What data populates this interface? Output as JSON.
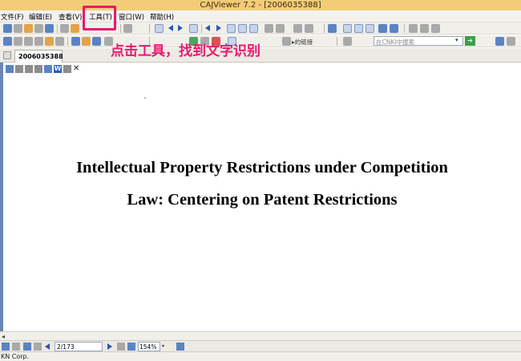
{
  "window": {
    "title": "CAJViewer 7.2 - [2006035388]"
  },
  "menu": [
    {
      "label": "文件(F)"
    },
    {
      "label": "编辑(E)"
    },
    {
      "label": "查看(V)"
    },
    {
      "label": "工具(T)"
    },
    {
      "label": "窗口(W)"
    },
    {
      "label": "帮助(H)"
    }
  ],
  "toolbar": {
    "link_label": "▸的链接",
    "search_placeholder": "在CNKI中搜索"
  },
  "document_tab": {
    "label": "2006035388"
  },
  "annotation": {
    "text": "点击工具，找到文字识别",
    "color": "#e8196f",
    "target": "工具(T)"
  },
  "document": {
    "title_line1": "Intellectual Property Restrictions under Competition",
    "title_line2": "Law: Centering on Patent Restrictions"
  },
  "navigation": {
    "page_value": "2/173",
    "zoom_value": "154%"
  },
  "status": {
    "text": "KN Corp."
  }
}
